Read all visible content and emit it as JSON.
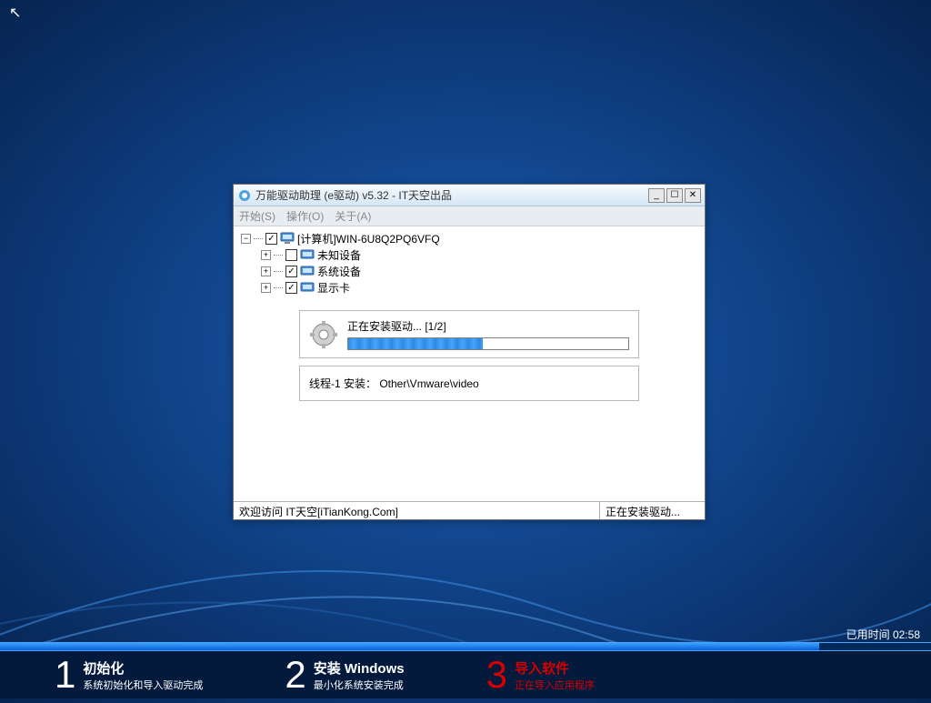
{
  "cursor_glyph": "↖",
  "time_label": "已用时间 02:58",
  "progress_percent": 88,
  "steps": [
    {
      "num": "1",
      "title": "初始化",
      "sub": "系统初始化和导入驱动完成",
      "state": "done"
    },
    {
      "num": "2",
      "title": "安装 Windows",
      "sub": "最小化系统安装完成",
      "state": "done"
    },
    {
      "num": "3",
      "title": "导入软件",
      "sub": "正在导入应用程序",
      "state": "active"
    }
  ],
  "window": {
    "title": "万能驱动助理 (e驱动) v5.32 - IT天空出品",
    "menus": [
      "开始(S)",
      "操作(O)",
      "关于(A)"
    ],
    "tree": {
      "root": "[计算机]WIN-6U8Q2PQ6VFQ",
      "children": [
        {
          "label": "未知设备",
          "checked": false
        },
        {
          "label": "系统设备",
          "checked": true
        },
        {
          "label": "显示卡",
          "checked": true
        }
      ]
    },
    "install": {
      "label": "正在安装驱动... [1/2]",
      "percent": 48
    },
    "thread": "线程-1 安装： Other\\Vmware\\video",
    "status_left": "欢迎访问 IT天空[iTianKong.Com]",
    "status_right": "正在安装驱动..."
  }
}
